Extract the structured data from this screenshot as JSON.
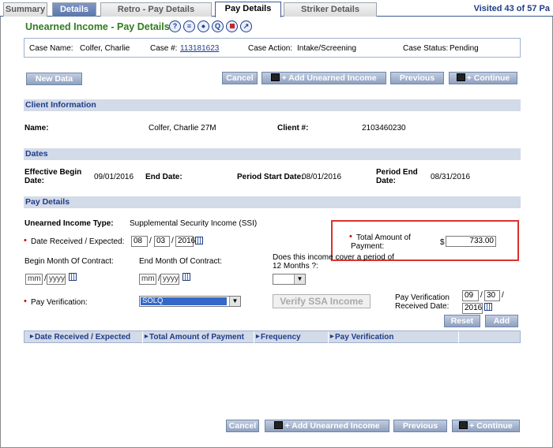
{
  "tabs": [
    {
      "label": "Summary",
      "style": "gray"
    },
    {
      "label": "Details",
      "style": "blue"
    },
    {
      "label": "Retro - Pay Details",
      "style": "gray"
    },
    {
      "label": "Pay Details",
      "style": "active"
    },
    {
      "label": "Striker Details",
      "style": "gray"
    }
  ],
  "visited_text": "Visited 43 of 57 Pa",
  "page_title": "Unearned Income - Pay Details",
  "title_icons": [
    "help-icon",
    "notes-icon",
    "person-icon",
    "query-icon",
    "stop-icon",
    "search-doc-icon"
  ],
  "case": {
    "name_label": "Case Name:",
    "name": "Colfer, Charlie",
    "number_label": "Case #:",
    "number": "113181623",
    "action_label": "Case Action:",
    "action": "Intake/Screening",
    "status_label": "Case Status:",
    "status": "Pending"
  },
  "buttons": {
    "new_data": "New Data",
    "cancel": "Cancel",
    "add_unearned": "Add Unearned Income",
    "previous": "Previous",
    "continue": "Continue",
    "reset": "Reset",
    "add": "Add"
  },
  "client_info": {
    "header": "Client Information",
    "name_label": "Name:",
    "name": "Colfer, Charlie 27M",
    "client_no_label": "Client #:",
    "client_no": "2103460230"
  },
  "dates": {
    "header": "Dates",
    "effective_label_1": "Effective Begin",
    "effective_label_2": "Date:",
    "effective": "09/01/2016",
    "end_label": "End Date:",
    "period_start_label": "Period Start Date:",
    "period_start": "08/01/2016",
    "period_end_label_1": "Period End",
    "period_end_label_2": "Date:",
    "period_end": "08/31/2016"
  },
  "pay_details": {
    "header": "Pay Details",
    "type_label": "Unearned Income Type:",
    "type": "Supplemental Security Income (SSI)",
    "date_received_label": "Date Received / Expected:",
    "dr_mm": "08",
    "dr_dd": "03",
    "dr_yyyy": "2016",
    "total_label_1": "Total Amount of",
    "total_label_2": "Payment:",
    "currency": "$",
    "total": "733.00",
    "begin_month_label": "Begin Month Of Contract:",
    "end_month_label": "End Month Of Contract:",
    "cover_label_1": "Does this income cover a period of",
    "cover_label_2": "12 Months ?:",
    "mm_placeholder": "mm",
    "yyyy_placeholder": "yyyy",
    "pay_verif_label": "Pay Verification:",
    "pay_verif_value": "SOLQ",
    "verify_ssa": "Verify SSA Income",
    "pv_date_label_1": "Pay Verification",
    "pv_date_label_2": "Received Date:",
    "pv_mm": "09",
    "pv_dd": "30",
    "pv_yyyy": "2016"
  },
  "table_headers": [
    "Date Received / Expected",
    "Total Amount of Payment",
    "Frequency",
    "Pay Verification"
  ]
}
